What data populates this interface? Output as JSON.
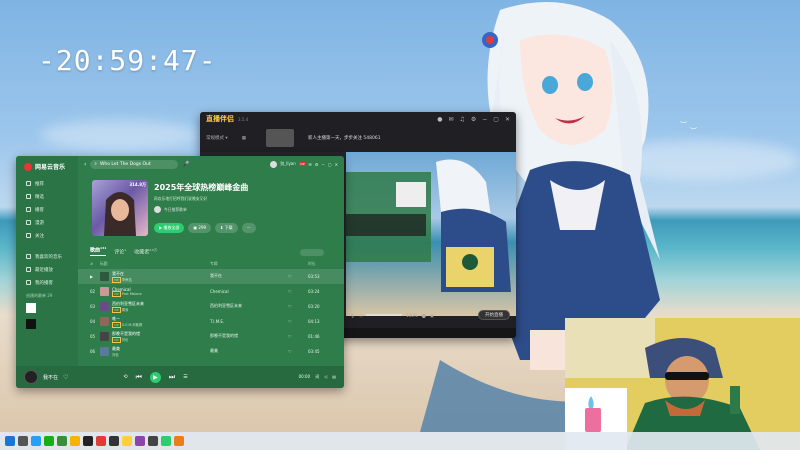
{
  "desktop": {
    "clock": "-20:59:47-"
  },
  "live_window": {
    "app_name": "直播伴侣",
    "version": "3.5.4",
    "mode_label": "常规模式 ▾",
    "notice_text": "新人主播第一天，步步关注 548061",
    "preview_label": "直播前",
    "start_button": "开始直播",
    "volume_label": "100%"
  },
  "music_window": {
    "brand": "网易云音乐",
    "search_value": "Who Let The Dogs Out",
    "account_name": "别_llyan",
    "nav": [
      {
        "label": "推荐"
      },
      {
        "label": "精选"
      },
      {
        "label": "播客"
      },
      {
        "label": "漫游"
      },
      {
        "label": "关注"
      }
    ],
    "my_section": [
      {
        "label": "我喜欢的音乐"
      },
      {
        "label": "最近播放"
      },
      {
        "label": "我的播客"
      }
    ],
    "playlist_section_label": "创建的歌单 29",
    "playlist": {
      "cover_tag": "314.8万",
      "title": "2025年全球热榜巅峰金曲",
      "desc": "再欢乐地打招呼我们说晚安又好",
      "creator": "今日推荐歌单",
      "play_label": "播放全部",
      "collect_label": "299",
      "download_label": "下载",
      "more_label": "···"
    },
    "tabs": [
      {
        "label": "歌曲",
        "count": "141"
      },
      {
        "label": "评论",
        "count": "1"
      },
      {
        "label": "收藏者",
        "count": "2.0万"
      }
    ],
    "table_headers": [
      "#",
      "标题",
      "专辑",
      "",
      "时长"
    ],
    "tracks": [
      {
        "num": "▶",
        "title": "我不在",
        "artist": "李荣浩",
        "album": "我不在",
        "duration": "03:53"
      },
      {
        "num": "02",
        "title": "Chemical",
        "artist": "Post Malone",
        "album": "Chemical",
        "duration": "03:24"
      },
      {
        "num": "03",
        "title": "西伯利亚雪区未来",
        "artist": "周深",
        "album": "西伯利亚雪区未来",
        "duration": "03:20"
      },
      {
        "num": "04",
        "title": "唯一",
        "artist": "G.E.M.邓紫棋",
        "album": "T.I.M.E.",
        "duration": "04:13"
      },
      {
        "num": "05",
        "title": "那晚不是我的错",
        "artist": "刘也",
        "album": "那晚不是我的错",
        "duration": "01:46"
      },
      {
        "num": "06",
        "title": "最美",
        "artist": "刘也",
        "album": "最美",
        "duration": "03:45"
      }
    ],
    "player": {
      "now_playing": "我不在",
      "time": "00:00"
    }
  }
}
